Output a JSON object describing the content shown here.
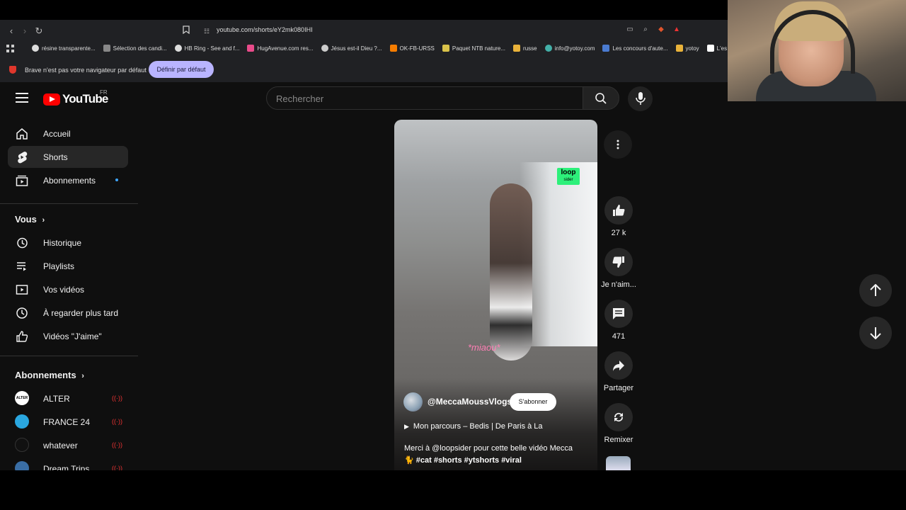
{
  "browser": {
    "url": "youtube.com/shorts/eY2mk080IHI",
    "bookmarks": [
      {
        "label": "résine transparente...",
        "color": "#dddddd"
      },
      {
        "label": "Sélection des candi...",
        "color": "#888888"
      },
      {
        "label": "HB Ring - See and f...",
        "color": "#dddddd"
      },
      {
        "label": "HugAvenue.com res...",
        "color": "#e94b8a"
      },
      {
        "label": "Jésus est-il Dieu ?...",
        "color": "#cccccc"
      },
      {
        "label": "OK-FB-URSS",
        "color": "#f57c00"
      },
      {
        "label": "Paquet NTB nature...",
        "color": "#d9c24a"
      },
      {
        "label": "russe",
        "color": "#e9b23a"
      },
      {
        "label": "info@yotoy.com",
        "color": "#43b0a8"
      },
      {
        "label": "Les concours d'aute...",
        "color": "#4a7bd0"
      },
      {
        "label": "yotoy",
        "color": "#e9b23a"
      },
      {
        "label": "L'es",
        "color": "#ffffff"
      }
    ],
    "default_notice": "Brave n'est pas votre navigateur par défaut",
    "default_button": "Définir par défaut"
  },
  "youtube": {
    "logo_text": "YouTube",
    "country": "FR",
    "search_placeholder": "Rechercher",
    "sidebar": {
      "main": [
        {
          "label": "Accueil",
          "icon": "home-icon"
        },
        {
          "label": "Shorts",
          "icon": "shorts-icon",
          "active": true
        },
        {
          "label": "Abonnements",
          "icon": "subscriptions-icon",
          "dot": true
        }
      ],
      "you_heading": "Vous",
      "you": [
        {
          "label": "Historique",
          "icon": "history-icon"
        },
        {
          "label": "Playlists",
          "icon": "playlists-icon"
        },
        {
          "label": "Vos vidéos",
          "icon": "your-videos-icon"
        },
        {
          "label": "À regarder plus tard",
          "icon": "watch-later-icon"
        },
        {
          "label": "Vidéos \"J'aime\"",
          "icon": "liked-videos-icon"
        }
      ],
      "subs_heading": "Abonnements",
      "subs": [
        {
          "label": "ALTER",
          "avatar_color": "#ffffff"
        },
        {
          "label": "FRANCE 24",
          "avatar_color": "#2aa7e0"
        },
        {
          "label": "whatever",
          "avatar_color": "#111111"
        },
        {
          "label": "Dream Trips",
          "avatar_color": "#3a6ea5"
        }
      ],
      "live_icon": "((·))"
    },
    "short": {
      "watermark": "loop",
      "watermark_sub": "sider",
      "overlay_text": "*miaou*",
      "channel": "@MeccaMoussVlogs",
      "subscribe": "S'abonner",
      "sound": "Mon parcours – Bedis | De Paris à La",
      "description_line1": "Merci à @loopsider pour cette belle vidéo Mecca",
      "description_line2": "🐈 #cat #shorts #ytshorts #viral"
    },
    "actions": {
      "likes": "27 k",
      "dislike": "Je n'aim...",
      "comments": "471",
      "share": "Partager",
      "remix": "Remixer"
    }
  }
}
